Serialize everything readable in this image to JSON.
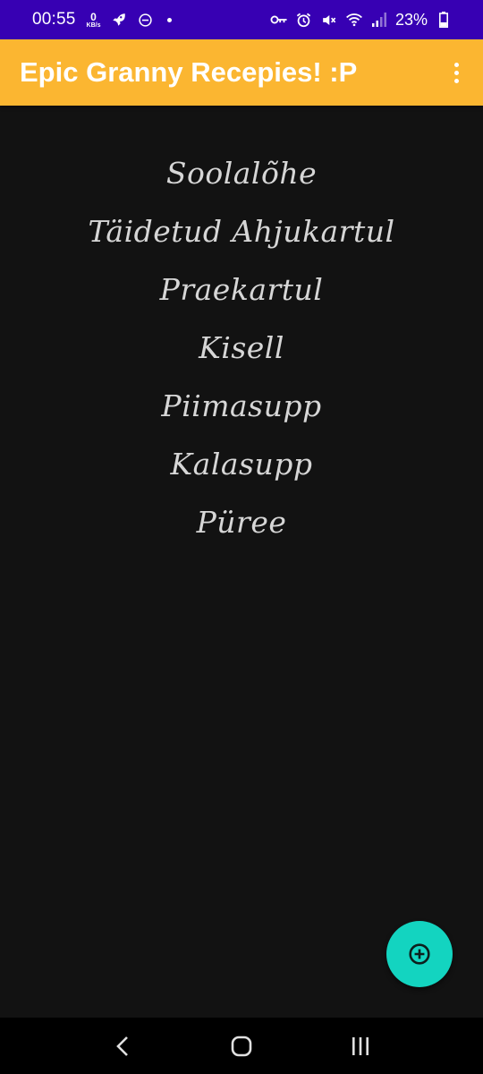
{
  "status_bar": {
    "time": "00:55",
    "net_speed_value": "0",
    "net_speed_unit": "KB/s",
    "battery_percent": "23%"
  },
  "app_bar": {
    "title": "Epic Granny Recepies! :P"
  },
  "recipes": [
    {
      "label": "Soolalõhe"
    },
    {
      "label": "Täidetud Ahjukartul"
    },
    {
      "label": "Praekartul"
    },
    {
      "label": "Kisell"
    },
    {
      "label": "Piimasupp"
    },
    {
      "label": "Kalasupp"
    },
    {
      "label": "Püree"
    }
  ],
  "colors": {
    "status_bar": "#3700b3",
    "app_bar": "#fbb631",
    "background": "#121212",
    "fab": "#13d4c0",
    "recipe_text": "#d6d6d6"
  },
  "icons": {
    "fab": "add-circle-icon",
    "nav_back": "back-icon",
    "nav_home": "home-icon",
    "nav_recents": "recents-icon"
  }
}
